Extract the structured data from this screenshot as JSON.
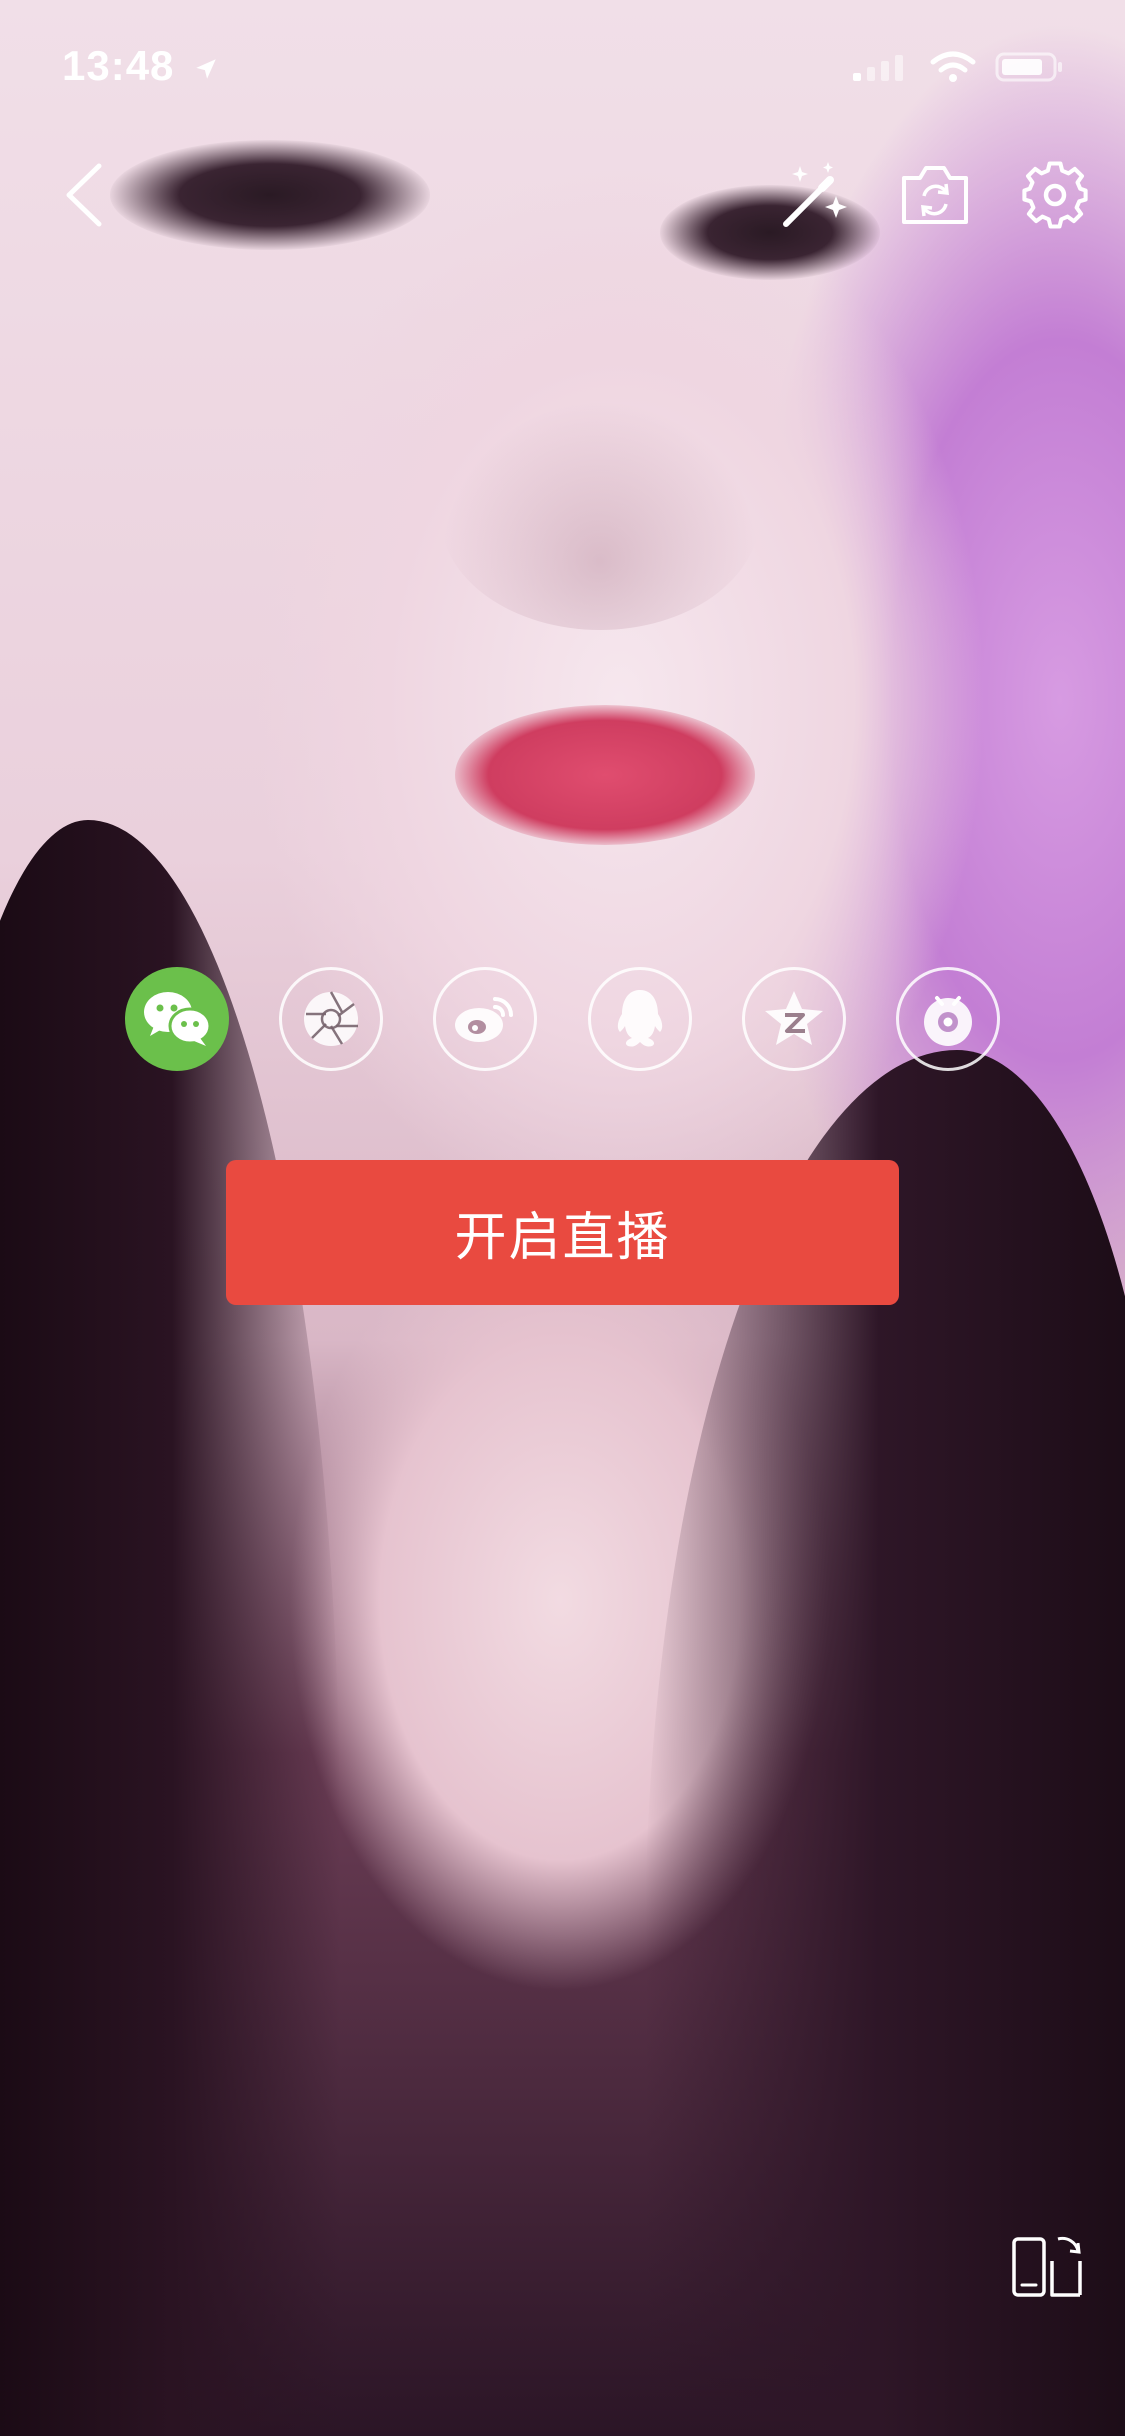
{
  "status_bar": {
    "time": "13:48"
  },
  "toolbar": {
    "back_icon": "chevron-left-icon",
    "beauty_icon": "magic-wand-icon",
    "flip_icon": "camera-flip-icon",
    "settings_icon": "gear-icon"
  },
  "share": {
    "items": [
      {
        "name": "wechat",
        "icon": "wechat-icon",
        "selected": true,
        "color": "#6bc04b"
      },
      {
        "name": "moments",
        "icon": "aperture-icon",
        "selected": false
      },
      {
        "name": "weibo",
        "icon": "weibo-icon",
        "selected": false
      },
      {
        "name": "qq",
        "icon": "qq-penguin-icon",
        "selected": false
      },
      {
        "name": "qzone",
        "icon": "qzone-star-icon",
        "selected": false
      },
      {
        "name": "other",
        "icon": "eye-badge-icon",
        "selected": false
      }
    ]
  },
  "start_live": {
    "label": "开启直播",
    "color": "#e94a40"
  },
  "orientation_toggle": {
    "icon": "rotate-phone-icon"
  }
}
